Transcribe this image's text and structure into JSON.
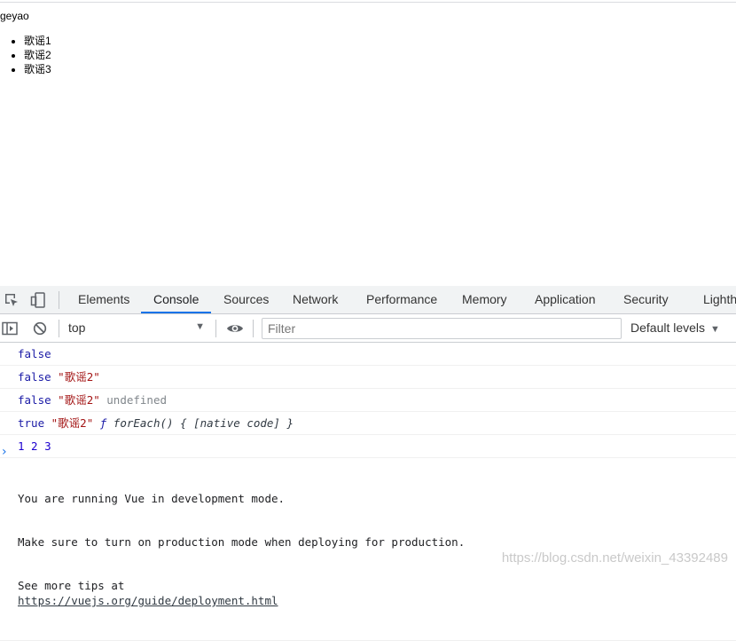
{
  "page": {
    "heading": "geyao",
    "songs": [
      "歌谣1",
      "歌谣2",
      "歌谣3"
    ]
  },
  "devtools": {
    "tabs": [
      {
        "label": "Elements"
      },
      {
        "label": "Console",
        "active": true
      },
      {
        "label": "Sources"
      },
      {
        "label": "Network"
      },
      {
        "label": "Performance"
      },
      {
        "label": "Memory"
      },
      {
        "label": "Application"
      },
      {
        "label": "Security"
      },
      {
        "label": "Lighth"
      }
    ],
    "toolbar": {
      "context": "top",
      "filter_placeholder": "Filter",
      "levels": "Default levels"
    },
    "console": [
      {
        "parts": [
          {
            "t": "false",
            "c": "kw"
          }
        ]
      },
      {
        "parts": [
          {
            "t": "false",
            "c": "kw"
          },
          {
            "t": " ",
            "c": ""
          },
          {
            "t": "\"歌谣2\"",
            "c": "str"
          }
        ]
      },
      {
        "parts": [
          {
            "t": "false",
            "c": "kw"
          },
          {
            "t": " ",
            "c": ""
          },
          {
            "t": "\"歌谣2\"",
            "c": "str"
          },
          {
            "t": " ",
            "c": ""
          },
          {
            "t": "undefined",
            "c": "undef"
          }
        ]
      },
      {
        "parts": [
          {
            "t": "true",
            "c": "kw"
          },
          {
            "t": " ",
            "c": ""
          },
          {
            "t": "\"歌谣2\"",
            "c": "str"
          },
          {
            "t": " ",
            "c": ""
          },
          {
            "t": "ƒ",
            "c": "fsym"
          },
          {
            "t": " forEach() { [native code] }",
            "c": "fn"
          }
        ]
      },
      {
        "parts": [
          {
            "t": "1 2 3",
            "c": "num"
          }
        ]
      }
    ],
    "vue_message": {
      "line1": "You are running Vue in development mode.",
      "line2": "Make sure to turn on production mode when deploying for production.",
      "line3_prefix": "See more tips at ",
      "line3_link": "https://vuejs.org/guide/deployment.html"
    },
    "prompt": "›"
  },
  "watermark": "https://blog.csdn.net/weixin_43392489",
  "colors": {
    "accent": "#1a73e8",
    "keyword": "#1a1aa6",
    "string": "#a31515"
  }
}
